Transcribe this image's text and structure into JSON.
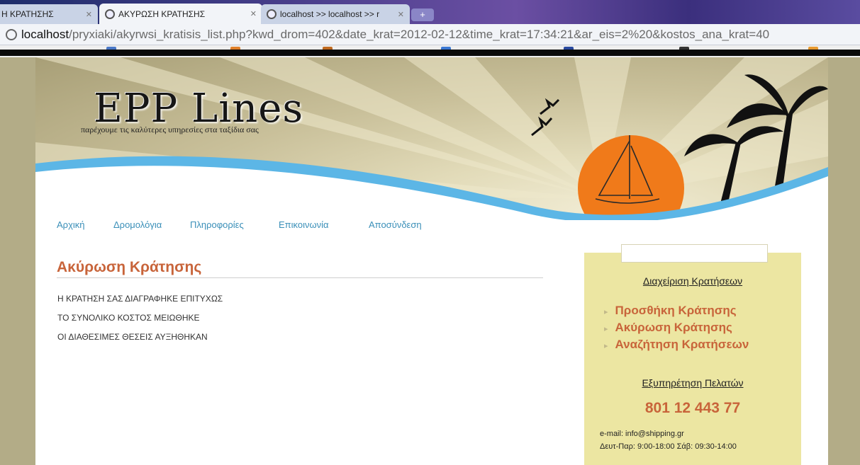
{
  "browser": {
    "tabs": [
      {
        "label": "Η ΚΡΑΤΗΣΗΣ",
        "active": false
      },
      {
        "label": "ΑΚΥΡΩΣΗ ΚΡΑΤΗΣΗΣ",
        "active": true
      },
      {
        "label": "localhost >> localhost >> r",
        "active": false
      }
    ],
    "new_tab": "+",
    "url_host": "localhost",
    "url_path": "/pryxiaki/akyrwsi_kratisis_list.php?kwd_drom=402&date_krat=2012-02-12&time_krat=17:34:21&ar_eis=2%20&kostos_ana_krat=40"
  },
  "site": {
    "logo_title": "EPP Lines",
    "logo_subtitle": "παρέχουμε τις καλύτερες υπηρεσίες στα ταξίδια σας",
    "nav": [
      "Αρχική",
      "Δρομολόγια",
      "Πληροφορίες",
      "Επικοινωνία",
      "Αποσύνδεση"
    ],
    "content": {
      "title": "Ακύρωση Κράτησης",
      "messages": [
        "Η ΚΡΑΤΗΣΗ ΣΑΣ ΔΙΑΓΡΑΦΗΚΕ ΕΠΙΤΥΧΩΣ",
        "ΤΟ ΣΥΝΟΛΙΚΟ ΚΟΣΤΟΣ ΜΕΙΩΘΗΚΕ",
        "ΟΙ ΔΙΑΘΕΣΙΜΕΣ ΘΕΣΕΙΣ ΑΥΞΗΘΗΚΑΝ"
      ]
    },
    "sidebar": {
      "heading_manage": "Διαχείριση Κρατήσεων",
      "links": [
        "Προσθήκη Κράτησης",
        "Ακύρωση Κράτησης",
        "Αναζήτηση Κρατήσεων"
      ],
      "heading_support": "Εξυπηρέτηση Πελατών",
      "phone": "801 12 443 77",
      "email": "e-mail: info@shipping.gr",
      "hours": "Δευτ-Παρ: 9:00-18:00 Σάβ: 09:30-14:00"
    }
  },
  "colors": {
    "accent": "#c8643a",
    "nav_link": "#3a8fb8",
    "sidebar_bg": "#ece6a2",
    "sea": "#5cb6e6",
    "sun": "#f07a1a"
  }
}
